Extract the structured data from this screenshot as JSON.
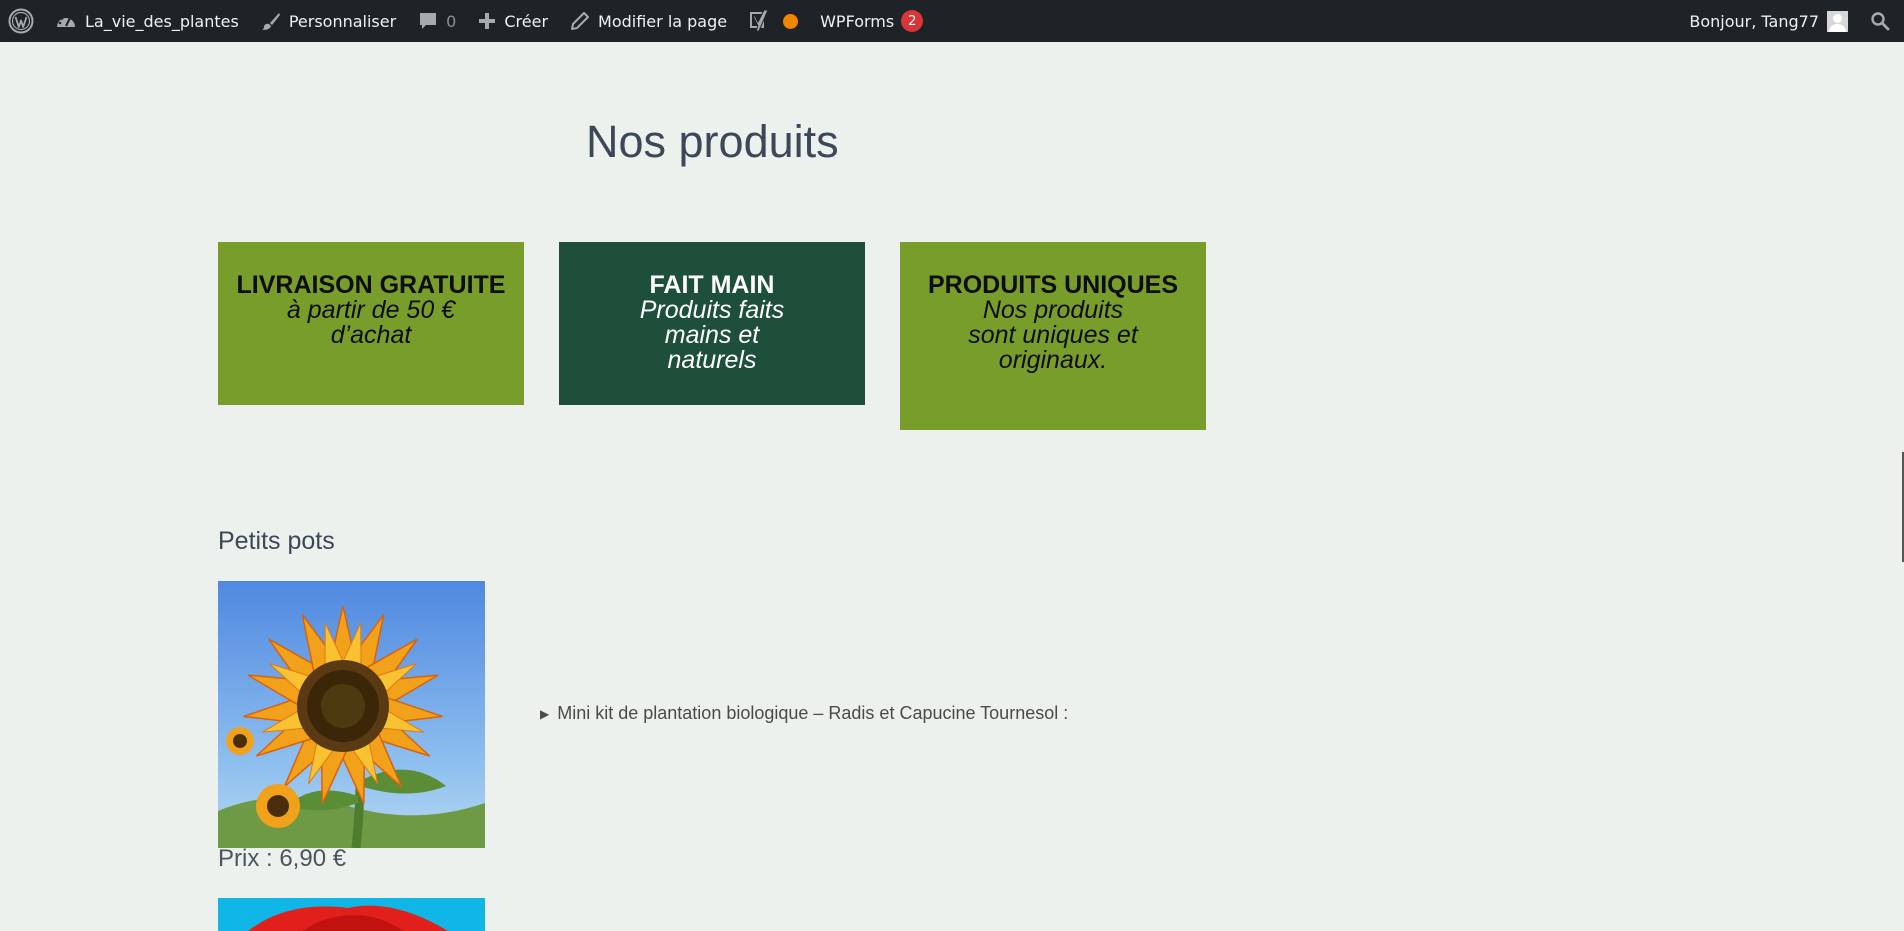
{
  "admin_bar": {
    "site_name": "La_vie_des_plantes",
    "customize_label": "Personnaliser",
    "comments_count": "0",
    "create_label": "Créer",
    "edit_page_label": "Modifier la page",
    "wpforms_label": "WPForms",
    "wpforms_badge": "2",
    "greeting": "Bonjour, Tang77"
  },
  "page": {
    "title": "Nos produits"
  },
  "features": [
    {
      "title": "LIVRAISON GRATUITE",
      "subtitle": "à partir de 50 € d’achat",
      "bg": "#789d2b",
      "text_color": "#0d0d0d"
    },
    {
      "title": "FAIT MAIN",
      "subtitle": "Produits faits mains et naturels",
      "bg": "#1e4f3b",
      "text_color": "#ffffff"
    },
    {
      "title": "PRODUITS UNIQUES",
      "subtitle": "Nos produits sont uniques et originaux.",
      "bg": "#789d2b",
      "text_color": "#0d0d0d"
    }
  ],
  "section": {
    "title": "Petits pots"
  },
  "product": {
    "image_icon": "sunflower-image",
    "summary": "Mini kit de plantation biologique – Radis et Capucine Tournesol :",
    "price": "Prix : 6,90 €"
  },
  "colors": {
    "admin_bar_bg": "#1d2327",
    "page_bg": "#edf1ed",
    "accent_green": "#789d2b",
    "dark_green": "#1e4f3b",
    "badge_red": "#d63638",
    "status_orange": "#f18500"
  }
}
